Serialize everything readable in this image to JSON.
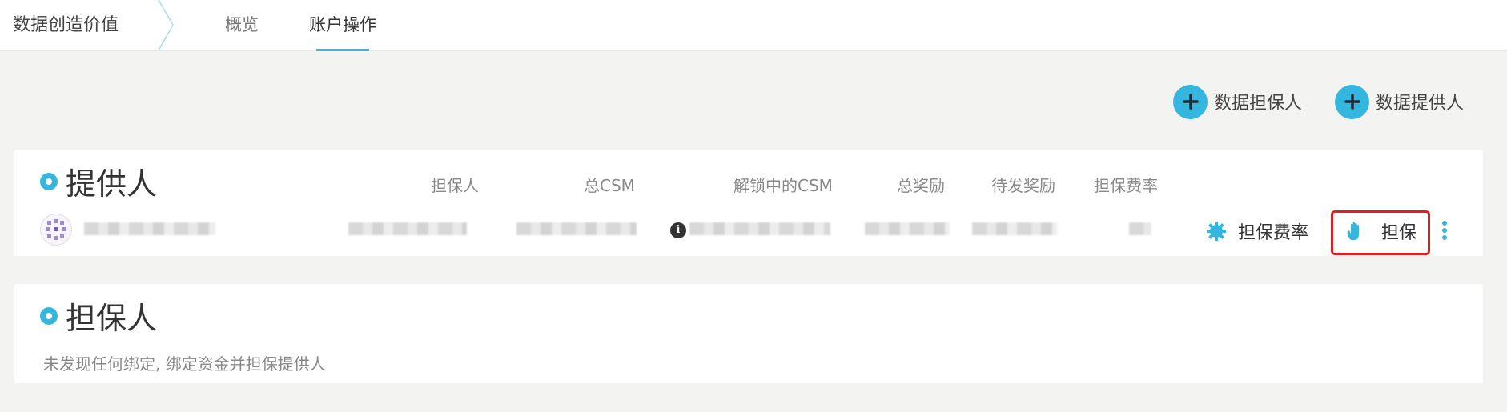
{
  "header": {
    "brand": "数据创造价值",
    "tabs": [
      {
        "label": "概览",
        "active": false
      },
      {
        "label": "账户操作",
        "active": true
      }
    ]
  },
  "actions": {
    "add_guarantor": "数据担保人",
    "add_provider": "数据提供人"
  },
  "providers": {
    "title": "提供人",
    "columns": [
      "担保人",
      "总CSM",
      "解锁中的CSM",
      "总奖励",
      "待发奖励",
      "担保费率"
    ],
    "row": {
      "rate_action": "担保费率",
      "guarantee_action": "担保"
    }
  },
  "guarantors": {
    "title": "担保人",
    "empty_message": "未发现任何绑定, 绑定资金并担保提供人"
  },
  "colors": {
    "accent": "#35b6de",
    "highlight": "#e11d1d"
  },
  "icons": [
    "plus-icon",
    "info-icon",
    "gear-icon",
    "hand-icon",
    "kebab-menu-icon",
    "chevron-right-icon"
  ]
}
